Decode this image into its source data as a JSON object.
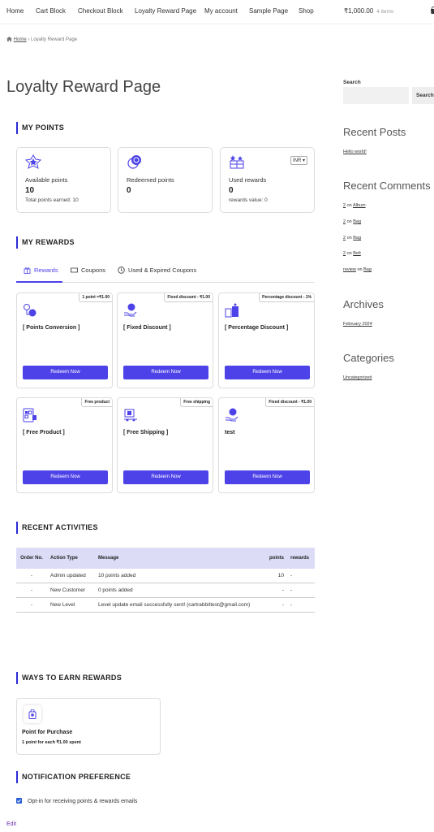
{
  "nav": {
    "items": [
      "Home",
      "Cart Block",
      "Checkout Block",
      "Loyalty Reward Page",
      "My account",
      "Sample Page",
      "Shop"
    ],
    "cart_total": "₹1,000.00",
    "cart_count": "4 items"
  },
  "breadcrumb": {
    "home": "Home",
    "separator": "›",
    "current": "Loyalty Reward Page"
  },
  "page_title": "Loyalty Reward Page",
  "my_points": {
    "heading": "MY POINTS",
    "available": {
      "label": "Available points",
      "value": "10",
      "sub": "Total points earned: 10"
    },
    "redeemed": {
      "label": "Redeemed points",
      "value": "0"
    },
    "used": {
      "label": "Used rewards",
      "value": "0",
      "sub": "rewards value: 0",
      "currency": "INR"
    }
  },
  "my_rewards": {
    "heading": "MY REWARDS",
    "tabs": [
      "Rewards",
      "Coupons",
      "Used & Expired Coupons"
    ],
    "cards": [
      {
        "badge": "1 point =₹1.00",
        "name": "[ Points Conversion ]",
        "button": "Redeem Now"
      },
      {
        "badge": "Fixed discount - ₹1.00",
        "name": "[ Fixed Discount ]",
        "button": "Redeem Now"
      },
      {
        "badge": "Percentage discount - 1%",
        "name": "[ Percentage Discount ]",
        "button": "Redeem Now"
      },
      {
        "badge": "Free product",
        "name": "[ Free Product ]",
        "button": "Redeem Now"
      },
      {
        "badge": "Free shipping",
        "name": "[ Free Shipping ]",
        "button": "Redeem Now"
      },
      {
        "badge": "Fixed discount - ₹1.00",
        "name": "test",
        "button": "Redeem Now"
      }
    ]
  },
  "recent_activities": {
    "heading": "RECENT ACTIVITIES",
    "columns": {
      "order": "Order No.",
      "action": "Action Type",
      "message": "Message",
      "points": "points",
      "rewards": "rewards"
    },
    "rows": [
      {
        "order": "-",
        "action": "Admin updated",
        "message": "10 points added",
        "points": "10",
        "rewards": "-"
      },
      {
        "order": "-",
        "action": "New Customer",
        "message": "0 points added",
        "points": "-",
        "rewards": "-"
      },
      {
        "order": "-",
        "action": "New Level",
        "message": "Level update email successfully sent! (cartrabbittest@gmail.com)",
        "points": "-",
        "rewards": "-"
      }
    ]
  },
  "ways_to_earn": {
    "heading": "WAYS TO EARN REWARDS",
    "card": {
      "title": "Point for Purchase",
      "sub": "1 point for each ₹1.00 spent"
    }
  },
  "notification": {
    "heading": "NOTIFICATION PREFERENCE",
    "optin_label": "Opt-in for receiving points & rewards emails",
    "checked": true
  },
  "edit_link": "Edit",
  "sidebar": {
    "search_label": "Search",
    "search_button": "Search",
    "recent_posts_heading": "Recent Posts",
    "recent_posts": [
      "Hello world!"
    ],
    "recent_comments_heading": "Recent Comments",
    "recent_comments": [
      {
        "author": "2",
        "on": "on",
        "post": "Album"
      },
      {
        "author": "2",
        "on": "on",
        "post": "Bag"
      },
      {
        "author": "2",
        "on": "on",
        "post": "Bag"
      },
      {
        "author": "2",
        "on": "on",
        "post": "Belt"
      },
      {
        "author": "review",
        "on": "on",
        "post": "Bag"
      }
    ],
    "archives_heading": "Archives",
    "archives": [
      "February 2024"
    ],
    "categories_heading": "Categories",
    "categories": [
      "Uncategorized"
    ]
  },
  "colors": {
    "accent": "#4c42e8",
    "table_header": "#dcdcf7",
    "section_bar": "#2b2bd6"
  }
}
